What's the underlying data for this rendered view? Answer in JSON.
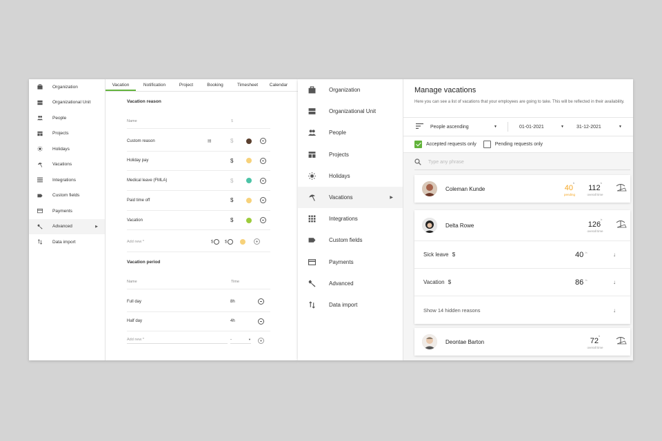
{
  "left": {
    "sidebar": [
      {
        "label": "Organization",
        "icon": "briefcase-icon"
      },
      {
        "label": "Organizational Unit",
        "icon": "unit-icon"
      },
      {
        "label": "People",
        "icon": "people-icon"
      },
      {
        "label": "Projects",
        "icon": "projects-icon"
      },
      {
        "label": "Holidays",
        "icon": "sun-icon"
      },
      {
        "label": "Vacations",
        "icon": "umbrella-icon"
      },
      {
        "label": "Integrations",
        "icon": "grid-icon"
      },
      {
        "label": "Custom fields",
        "icon": "tag-icon"
      },
      {
        "label": "Payments",
        "icon": "card-icon"
      },
      {
        "label": "Advanced",
        "icon": "wrench-icon",
        "active": true
      },
      {
        "label": "Data import",
        "icon": "import-icon"
      }
    ],
    "tabs": [
      "Vacation",
      "Notification",
      "Project",
      "Booking",
      "Timesheet",
      "Calendar"
    ],
    "reason_title": "Vacation reason",
    "reason_col_name": "Name",
    "reason_col_paid": "$",
    "reasons": [
      {
        "name": "Custom reason",
        "color": "#5a3f2e"
      },
      {
        "name": "Holiday pay",
        "color": "#f7d27a"
      },
      {
        "name": "Medical leave (FMLA)",
        "color": "#4cc3a6"
      },
      {
        "name": "Paid time off",
        "color": "#f7d27a"
      },
      {
        "name": "Vacation",
        "color": "#9ccb3c"
      }
    ],
    "reason_add_placeholder": "Add new *",
    "period_title": "Vacation period",
    "period_col_name": "Name",
    "period_col_time": "Time",
    "periods": [
      {
        "name": "Full day",
        "time": "8h"
      },
      {
        "name": "Half day",
        "time": "4h"
      }
    ],
    "period_add_placeholder": "Add new *",
    "period_add_time": "-"
  },
  "right": {
    "sidebar": [
      {
        "label": "Organization",
        "icon": "briefcase-icon"
      },
      {
        "label": "Organizational Unit",
        "icon": "unit-icon"
      },
      {
        "label": "People",
        "icon": "people-icon"
      },
      {
        "label": "Projects",
        "icon": "projects-icon"
      },
      {
        "label": "Holidays",
        "icon": "sun-icon"
      },
      {
        "label": "Vacations",
        "icon": "umbrella-icon",
        "active": true
      },
      {
        "label": "Integrations",
        "icon": "grid-icon"
      },
      {
        "label": "Custom fields",
        "icon": "tag-icon"
      },
      {
        "label": "Payments",
        "icon": "card-icon"
      },
      {
        "label": "Advanced",
        "icon": "wrench-icon"
      },
      {
        "label": "Data import",
        "icon": "import-icon"
      }
    ],
    "title": "Manage vacations",
    "description": "Here you can see a list of vacations that your employees are going to take. This will be reflected in their availability.",
    "sort": "People ascending",
    "date_from": "01-01-2021",
    "date_to": "31-12-2021",
    "accepted_label": "Accepted requests only",
    "accepted_checked": true,
    "pending_label": "Pending requests only",
    "pending_checked": false,
    "search_placeholder": "Type any phrase",
    "people": [
      {
        "name": "Coleman Kunde",
        "pending": "40",
        "pending_unit": "h",
        "pending_label": "pending",
        "overall": "112",
        "overall_unit": "h",
        "overall_label": "overall time"
      },
      {
        "name": "Delta Rowe",
        "overall": "126",
        "overall_unit": "h",
        "overall_label": "overall time",
        "reasons": [
          {
            "name": "Sick leave",
            "hours": "40",
            "unit": "h"
          },
          {
            "name": "Vacation",
            "hours": "86",
            "unit": "h"
          }
        ],
        "show_hidden": "Show 14 hidden reasons"
      },
      {
        "name": "Deontae Barton",
        "overall": "72",
        "overall_unit": "h",
        "overall_label": "overall time"
      }
    ],
    "accent": "#62b33b",
    "pending_color": "#f5a623"
  }
}
